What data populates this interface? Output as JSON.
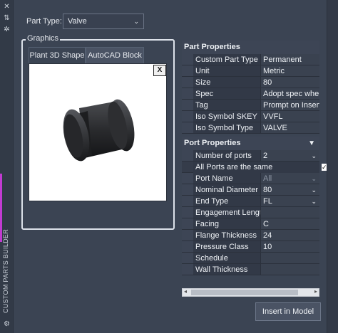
{
  "sidebar": {
    "vertical_label": "CUSTOM PARTS BUILDER",
    "accent_color": "#c13bd1"
  },
  "part_type": {
    "label": "Part Type:",
    "value": "Valve"
  },
  "graphics": {
    "title": "Graphics",
    "tabs": [
      "Plant 3D Shape",
      "AutoCAD Block"
    ],
    "close_label": "X"
  },
  "part_properties": {
    "title": "Part Properties",
    "rows": [
      {
        "name": "Custom Part Type",
        "value": "Permanent"
      },
      {
        "name": "Unit",
        "value": "Metric"
      },
      {
        "name": "Size",
        "value": "80"
      },
      {
        "name": "Spec",
        "value": "Adopt spec when p"
      },
      {
        "name": "Tag",
        "value": "Prompt on Insert"
      },
      {
        "name": "Iso Symbol SKEY",
        "value": "VVFL"
      },
      {
        "name": "Iso Symbol Type",
        "value": "VALVE"
      }
    ]
  },
  "port_properties": {
    "title": "Port Properties",
    "rows": [
      {
        "name": "Number of ports",
        "value": "2",
        "dropdown": true
      },
      {
        "name": "All Ports are the same",
        "value": "",
        "checkbox": true
      },
      {
        "name": "Port Name",
        "value": "All",
        "dropdown": true,
        "dim": true
      },
      {
        "name": "Nominal Diameter",
        "value": "80",
        "dropdown": true
      },
      {
        "name": "End Type",
        "value": "FL",
        "dropdown": true
      },
      {
        "name": "Engagement Length",
        "value": ""
      },
      {
        "name": "Facing",
        "value": "C"
      },
      {
        "name": "Flange Thickness",
        "value": "24"
      },
      {
        "name": "Pressure Class",
        "value": "10"
      },
      {
        "name": "Schedule",
        "value": ""
      },
      {
        "name": "Wall Thickness",
        "value": ""
      }
    ]
  },
  "insert_button": "Insert in Model"
}
